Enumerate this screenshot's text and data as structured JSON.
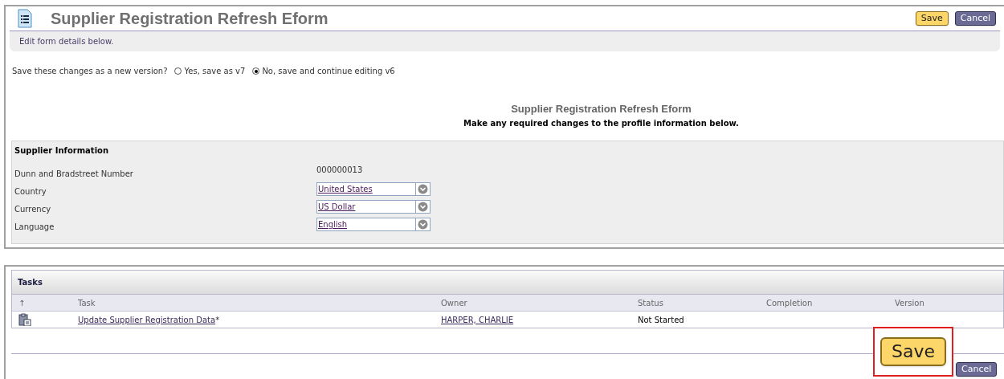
{
  "header": {
    "title": "Supplier Registration Refresh Eform",
    "buttons": [
      {
        "kind": "save",
        "label": "Save"
      },
      {
        "kind": "cancel",
        "label": "Cancel"
      }
    ]
  },
  "instructions": "Edit form details below.",
  "version_choice": {
    "question": "Save these changes as a new version?",
    "options": [
      {
        "label": "Yes, save as v7",
        "selected": false
      },
      {
        "label": "No, save and continue editing v6",
        "selected": true
      }
    ]
  },
  "form_title": "Supplier Registration Refresh Eform",
  "form_subtitle": "Make any required changes to the profile information below.",
  "supplier_information": {
    "title": "Supplier Information",
    "fields": [
      {
        "kind": "text",
        "label": "Dunn and Bradstreet Number",
        "value": "000000013"
      },
      {
        "kind": "dropdown",
        "label": "Country",
        "value": "United States"
      },
      {
        "kind": "dropdown",
        "label": "Currency",
        "value": "US Dollar"
      },
      {
        "kind": "dropdown",
        "label": "Language",
        "value": "English"
      }
    ]
  },
  "tasks": {
    "title": "Tasks",
    "columns": [
      "↑",
      "Task",
      "Owner",
      "Status",
      "Completion",
      "Version"
    ],
    "rows": [
      {
        "task": "Update Supplier Registration Data",
        "task_suffix": "*",
        "owner": "HARPER, CHARLIE",
        "status": "Not Started"
      }
    ]
  },
  "footer_buttons": [
    {
      "kind": "save",
      "label": "Save",
      "highlighted": true
    },
    {
      "kind": "cancel",
      "label": "Cancel",
      "highlighted": false
    }
  ]
}
